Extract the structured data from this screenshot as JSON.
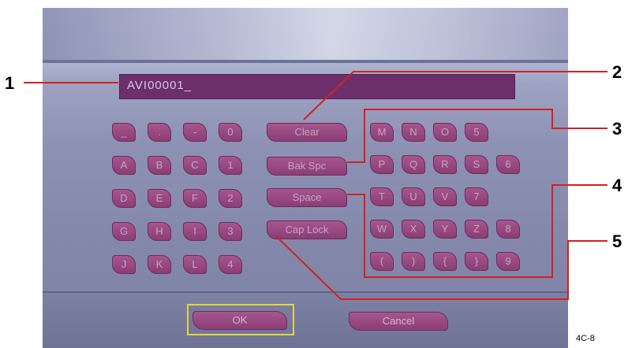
{
  "input": {
    "value": "AVI00001_"
  },
  "keypad_left": [
    [
      "_",
      ".",
      "-",
      "0"
    ],
    [
      "A",
      "B",
      "C",
      "1"
    ],
    [
      "D",
      "E",
      "F",
      "2"
    ],
    [
      "G",
      "H",
      "I",
      "3"
    ],
    [
      "J",
      "K",
      "L",
      "4"
    ]
  ],
  "function_keys": [
    "Clear",
    "Bak Spc",
    "Space",
    "Cap Lock"
  ],
  "keypad_right": [
    [
      "M",
      "N",
      "O",
      "5"
    ],
    [
      "P",
      "Q",
      "R",
      "S",
      "6"
    ],
    [
      "T",
      "U",
      "V",
      "7"
    ],
    [
      "W",
      "X",
      "Y",
      "Z",
      "8"
    ],
    [
      "(",
      ")",
      "{",
      "}",
      "9"
    ]
  ],
  "buttons": {
    "ok": "OK",
    "cancel": "Cancel"
  },
  "callouts": {
    "c1": "1",
    "c2": "2",
    "c3": "3",
    "c4": "4",
    "c5": "5"
  },
  "figure_id": "4C-8",
  "colors": {
    "key": "#9a4a82",
    "field": "#6c2f6c",
    "callout_line": "#d42020",
    "focus_frame": "#e8d33a"
  }
}
